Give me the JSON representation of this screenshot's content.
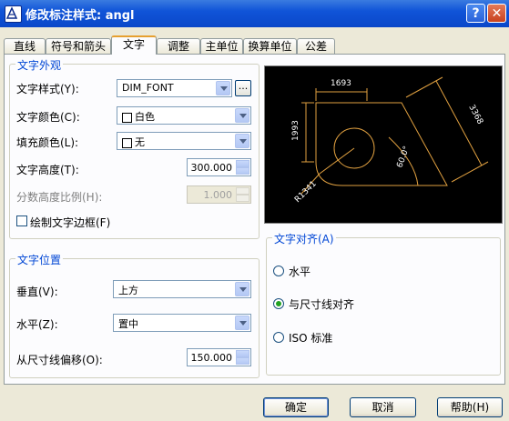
{
  "window": {
    "title": "修改标注样式: angl",
    "help_glyph": "?",
    "close_glyph": "✕"
  },
  "tabs": [
    {
      "label": "直线"
    },
    {
      "label": "符号和箭头"
    },
    {
      "label": "文字"
    },
    {
      "label": "调整"
    },
    {
      "label": "主单位"
    },
    {
      "label": "换算单位"
    },
    {
      "label": "公差"
    }
  ],
  "active_tab": "文字",
  "appearance": {
    "title": "文字外观",
    "style_label": "文字样式(Y):",
    "style_value": "DIM_FONT",
    "browse_label": "...",
    "color_label": "文字颜色(C):",
    "color_value": "白色",
    "fill_label": "填充颜色(L):",
    "fill_value": "无",
    "height_label": "文字高度(T):",
    "height_value": "300.000",
    "fraction_label": "分数高度比例(H):",
    "fraction_value": "1.000",
    "frame_label": "绘制文字边框(F)",
    "frame_checked": false
  },
  "placement": {
    "title": "文字位置",
    "vertical_label": "垂直(V):",
    "vertical_value": "上方",
    "horizontal_label": "水平(Z):",
    "horizontal_value": "置中",
    "offset_label": "从尺寸线偏移(O):",
    "offset_value": "150.000"
  },
  "alignment": {
    "title": "文字对齐(A)",
    "options": [
      {
        "label": "水平",
        "selected": false
      },
      {
        "label": "与尺寸线对齐",
        "selected": true
      },
      {
        "label": "ISO 标准",
        "selected": false
      }
    ]
  },
  "preview": {
    "dim_top": "1693",
    "dim_left": "1993",
    "dim_right": "3368",
    "dim_angle": "60.0°",
    "dim_radius": "R1341",
    "line_color": "#e0a040",
    "text_color": "#ffffff"
  },
  "buttons": {
    "ok": "确定",
    "cancel": "取消",
    "help": "帮助(H)"
  }
}
